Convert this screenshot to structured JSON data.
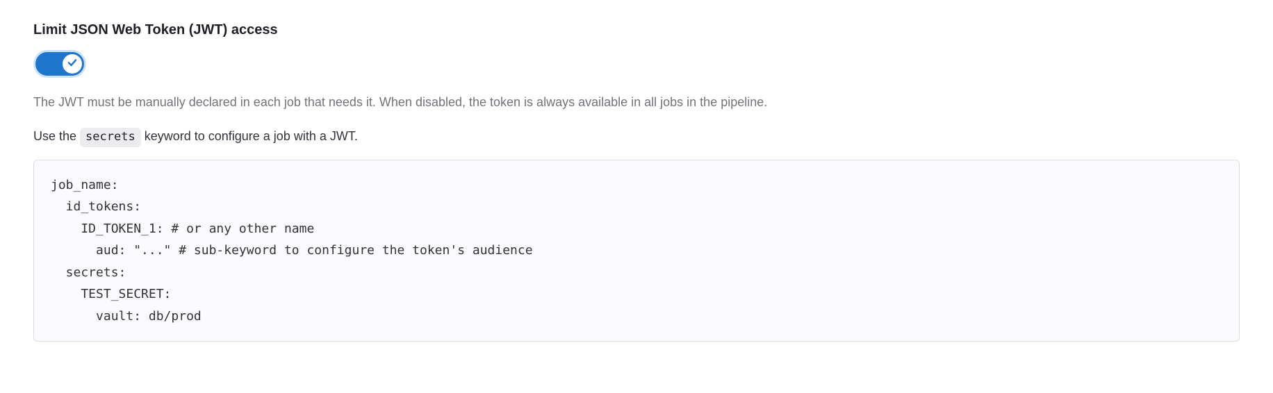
{
  "heading": "Limit JSON Web Token (JWT) access",
  "toggle_state": "on",
  "description": "The JWT must be manually declared in each job that needs it. When disabled, the token is always available in all jobs in the pipeline.",
  "instruction_prefix": "Use the ",
  "instruction_keyword": "secrets",
  "instruction_suffix": " keyword to configure a job with a JWT.",
  "code_snippet": "job_name:\n  id_tokens:\n    ID_TOKEN_1: # or any other name\n      aud: \"...\" # sub-keyword to configure the token's audience\n  secrets:\n    TEST_SECRET:\n      vault: db/prod"
}
